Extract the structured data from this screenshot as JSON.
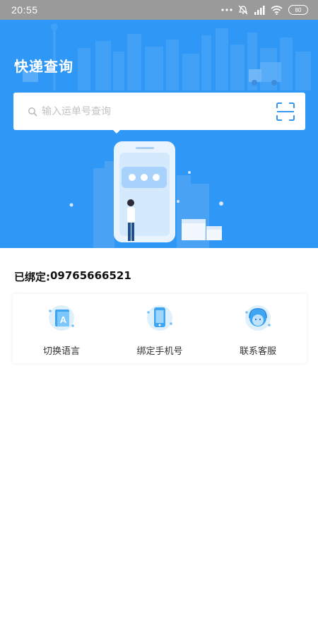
{
  "status_bar": {
    "time": "20:55",
    "battery": "80",
    "icons": [
      "more-dots-icon",
      "muted-alarm-icon",
      "signal-icon",
      "wifi-icon",
      "battery-icon"
    ]
  },
  "header": {
    "title": "快递查询",
    "background_color": "#2f97f5"
  },
  "search": {
    "placeholder": "输入运单号查询",
    "value": ""
  },
  "bound": {
    "label": "已绑定: ",
    "phone": "09765666521"
  },
  "functions": [
    {
      "label": "切换语言",
      "icon": "language-switch-icon"
    },
    {
      "label": "绑定手机号",
      "icon": "phone-bind-icon"
    },
    {
      "label": "联系客服",
      "icon": "customer-service-icon"
    }
  ]
}
